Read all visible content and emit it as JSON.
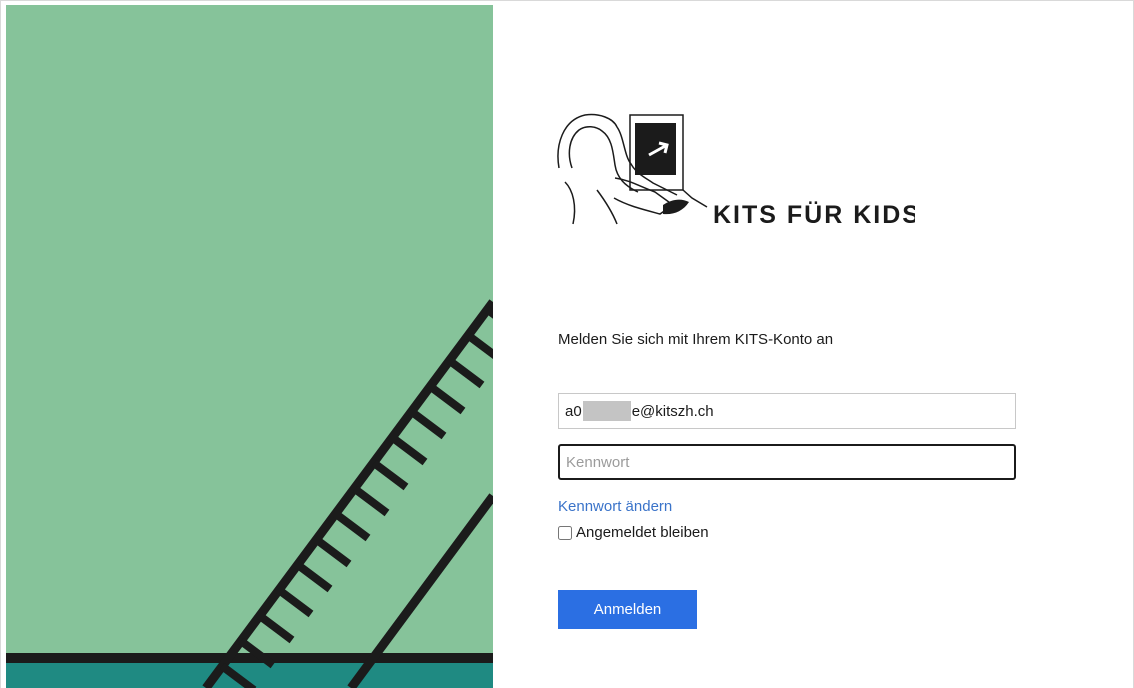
{
  "login": {
    "brand": "KITS FÜR KIDS",
    "prompt": "Melden Sie sich mit Ihrem KITS-Konto an",
    "username_prefix": "a0",
    "username_suffix": "e@kitszh.ch",
    "password_placeholder": "Kennwort",
    "change_password_link": "Kennwort ändern",
    "remember_label": "Angemeldet bleiben",
    "remember_checked": false,
    "signin_button": "Anmelden"
  },
  "colors": {
    "background_green": "#86c39a",
    "background_teal": "#1f8a82",
    "stripe_black": "#1b1b1b",
    "link_blue": "#3a73c9",
    "button_blue": "#2b6fe3"
  },
  "icons": {
    "logo": "child-at-computer-logo"
  }
}
